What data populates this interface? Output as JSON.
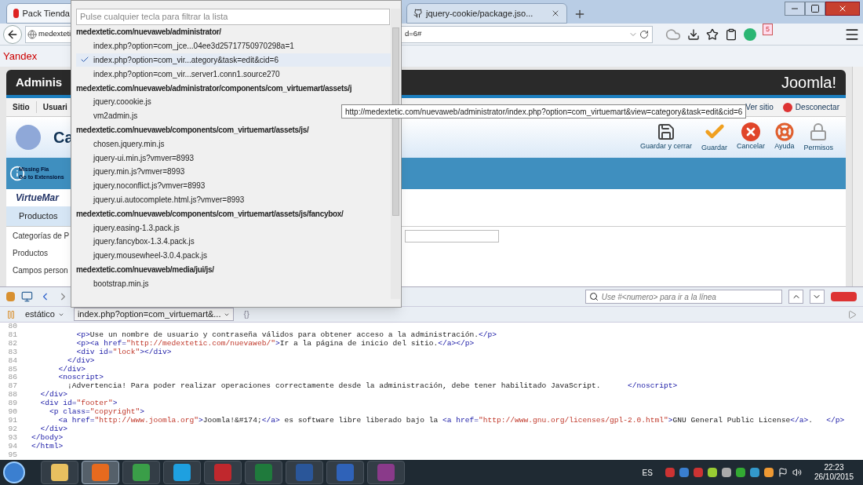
{
  "browser": {
    "tabs": [
      {
        "label": "Pack Tienda",
        "selected": true
      },
      {
        "label": "jquery-cookie/package.jso...",
        "selected": false
      }
    ],
    "url_start": "medexteti",
    "url_end": "d=6#",
    "badge": "5",
    "bookmark": "Yandex"
  },
  "page": {
    "header_title": "Adminis",
    "logo_text": "Joomla!",
    "menu": [
      "Sitio",
      "Usuari"
    ],
    "links": [
      "Ver sitio",
      "Desconectar"
    ],
    "page_title": "Ca",
    "toolbar_buttons": [
      {
        "label": "Guardar y cerrar",
        "kind": "save"
      },
      {
        "label": "Guardar",
        "kind": "check"
      },
      {
        "label": "Cancelar",
        "kind": "cancel"
      },
      {
        "label": "Ayuda",
        "kind": "help"
      },
      {
        "label": "Permisos",
        "kind": "lock"
      }
    ],
    "notice": [
      "Missing Fla",
      "Go to Extensions"
    ],
    "vm_logo": "VirtueMar",
    "side_tab": "Productos",
    "sidebar": [
      "Categorías de P",
      "Productos",
      "Campos person"
    ]
  },
  "tooltip": "http://medextetic.com/nuevaweb/administrator/index.php?option=com_virtuemart&view=category&task=edit&cid=6",
  "dropdown": {
    "placeholder": "Pulse cualquier tecla para filtrar la lista",
    "groups": [
      {
        "header": "medextetic.com/nuevaweb/administrator/",
        "items": [
          {
            "label": "index.php?option=com_jce...04ee3d25717750970298a=1",
            "selected": false
          },
          {
            "label": "index.php?option=com_vir...ategory&task=edit&cid=6",
            "selected": true
          },
          {
            "label": "index.php?option=com_vir...server1.conn1.source270",
            "selected": false
          }
        ]
      },
      {
        "header": "medextetic.com/nuevaweb/administrator/components/com_virtuemart/assets/j",
        "items": [
          {
            "label": "jquery.coookie.js",
            "selected": false
          },
          {
            "label": "vm2admin.js",
            "selected": false
          }
        ]
      },
      {
        "header": "medextetic.com/nuevaweb/components/com_virtuemart/assets/js/",
        "items": [
          {
            "label": "chosen.jquery.min.js",
            "selected": false
          },
          {
            "label": "jquery-ui.min.js?vmver=8993",
            "selected": false
          },
          {
            "label": "jquery.min.js?vmver=8993",
            "selected": false
          },
          {
            "label": "jquery.noconflict.js?vmver=8993",
            "selected": false
          },
          {
            "label": "jquery.ui.autocomplete.html.js?vmver=8993",
            "selected": false
          }
        ]
      },
      {
        "header": "medextetic.com/nuevaweb/components/com_virtuemart/assets/js/fancybox/",
        "items": [
          {
            "label": "jquery.easing-1.3.pack.js",
            "selected": false
          },
          {
            "label": "jquery.fancybox-1.3.4.pack.js",
            "selected": false
          },
          {
            "label": "jquery.mousewheel-3.0.4.pack.js",
            "selected": false
          }
        ]
      },
      {
        "header": "medextetic.com/nuevaweb/media/jui/js/",
        "items": [
          {
            "label": "bootstrap.min.js",
            "selected": false
          }
        ]
      }
    ]
  },
  "devtools": {
    "search_placeholder": "Use #<numero> para ir a la línea",
    "mode": "estático",
    "script": "index.php?option=com_virtuemart&...",
    "pretty_print": "{}",
    "lines": [
      {
        "number": "80"
      },
      {
        "number": "81",
        "text": "          <p>Use un nombre de usuario y contraseña válidos para obtener acceso a la administración.</p>"
      },
      {
        "number": "82",
        "text": "          <p><a href=\"http://medextetic.com/nuevaweb/\">Ir a la página de inicio del sitio.</a></p>"
      },
      {
        "number": "83",
        "text": "          <div id=\"lock\"></div>"
      },
      {
        "number": "84",
        "text": "        </div>"
      },
      {
        "number": "85",
        "text": "      </div>"
      },
      {
        "number": "86",
        "text": "      <noscript>"
      },
      {
        "number": "87",
        "text": "        ¡Advertencia! Para poder realizar operaciones correctamente desde la administración, debe tener habilitado JavaScript.      </noscript>"
      },
      {
        "number": "88",
        "text": "  </div>"
      },
      {
        "number": "89",
        "text": "  <div id=\"footer\">"
      },
      {
        "number": "90",
        "text": "    <p class=\"copyright\">"
      },
      {
        "number": "91",
        "text": "      <a href=\"http://www.joomla.org\">Joomla!&#174;</a> es software libre liberado bajo la <a href=\"http://www.gnu.org/licenses/gpl-2.0.html\">GNU General Public License</a>.   </p>"
      },
      {
        "number": "92",
        "text": "  </div>"
      },
      {
        "number": "93",
        "text": "</body>"
      },
      {
        "number": "94",
        "text": "</html>"
      },
      {
        "number": "95"
      }
    ]
  },
  "taskbar": {
    "apps": [
      {
        "kind": "folder",
        "selected": false
      },
      {
        "kind": "firefox",
        "selected": true
      },
      {
        "kind": "chrome",
        "selected": false
      },
      {
        "kind": "skype",
        "selected": false
      },
      {
        "kind": "flash",
        "selected": false
      },
      {
        "kind": "excel",
        "selected": false
      },
      {
        "kind": "word",
        "selected": false
      },
      {
        "kind": "floppy",
        "selected": false
      },
      {
        "kind": "archive",
        "selected": false
      }
    ],
    "language": "ES",
    "time": "22:23",
    "date": "26/10/2015"
  }
}
